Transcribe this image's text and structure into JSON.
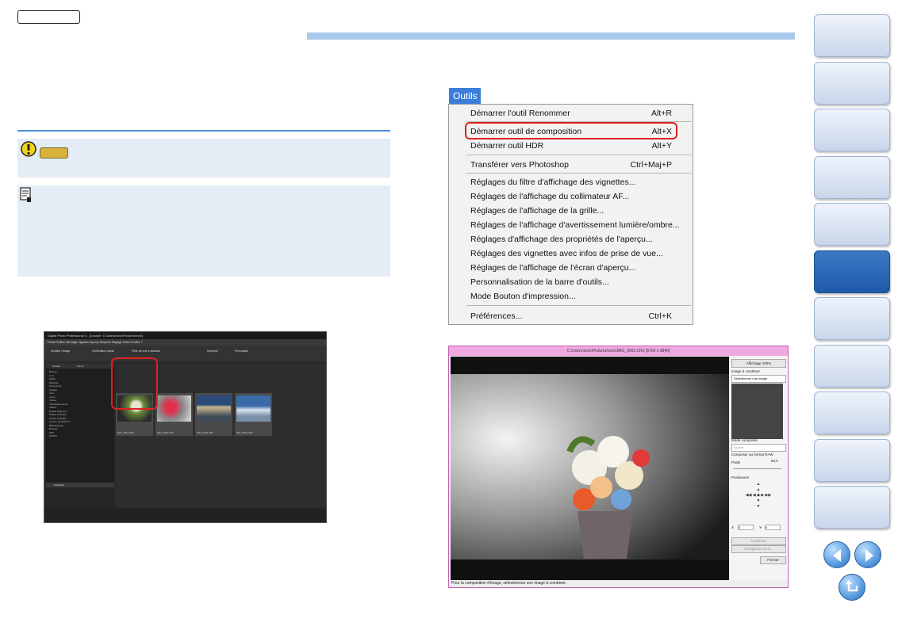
{
  "tools_menu": {
    "tab_label": "Outils",
    "items": [
      {
        "label": "Démarrer l'outil Renommer",
        "shortcut": "Alt+R"
      },
      {
        "label": "Démarrer outil de composition",
        "shortcut": "Alt+X"
      },
      {
        "label": "Démarrer outil HDR",
        "shortcut": "Alt+Y"
      },
      {
        "label": "Transférer vers Photoshop",
        "shortcut": "Ctrl+Maj+P"
      },
      {
        "label": "Réglages du filtre d'affichage des vignettes...",
        "shortcut": ""
      },
      {
        "label": "Réglages de l'affichage du collimateur AF...",
        "shortcut": ""
      },
      {
        "label": "Réglages de l'affichage de la grille...",
        "shortcut": ""
      },
      {
        "label": "Réglages de l'affichage d'avertissement lumière/ombre...",
        "shortcut": ""
      },
      {
        "label": "Réglages d'affichage des propriétés de l'aperçu...",
        "shortcut": ""
      },
      {
        "label": "Réglages des vignettes avec infos de prise de vue...",
        "shortcut": ""
      },
      {
        "label": "Réglages de l'affichage de l'écran d'aperçu...",
        "shortcut": ""
      },
      {
        "label": "Personnalisation de la barre d'outils...",
        "shortcut": ""
      },
      {
        "label": "Mode Bouton d'impression...",
        "shortcut": ""
      },
      {
        "label": "Préférences...",
        "shortcut": "Ctrl+K"
      }
    ]
  },
  "dpp_window": {
    "title": "Digital Photo Professional 4 - [Dossier: C:\\Users\\xxxx\\Pictures\\xxxx]",
    "menu": "Fichier  Edition  Affichage  Vignettes  Aperçu  Etiquette  Réglage  Outils  Fenêtre  ?",
    "toolbar": {
      "btn1": "Modifier l'image",
      "btn2": "Vérification rapide",
      "btn3": "Prise de vue à distance",
      "btn4": "Imprimer",
      "btn5": "Principales"
    },
    "tree_tabs": {
      "tab1": "Dossier",
      "tab2": "Favori"
    },
    "tree_items": [
      "Bureau",
      "xxxx",
      "Public",
      "Musique",
      "Documents",
      "Images",
      "xxxx",
      "xxxxx",
      "Vidéos",
      "Téléchargements",
      "Vidéos",
      "Disque local (C:)",
      "Disque local (D:)",
      "Disque local (E:)",
      "Lecteur de DVD (F:)",
      "Bibliothèques",
      "Réseau",
      "XXX",
      "XXXXX"
    ],
    "collection_label": "Collection",
    "thumbnails": [
      "IMG_0001.CR2",
      "IMG_0002.CR2",
      "IMG_0003.CR2",
      "IMG_0004.CR2"
    ]
  },
  "comp_window": {
    "title": "C:\\Users\\xxxx\\Pictures\\xxxx\\IMG_0001.CR2 [5760 x 3840]",
    "zoom_button": "Affichage 100%",
    "combine_label": "Image à combiner",
    "combine_select": "Sélectionner une image",
    "mode_label": "Mode composite",
    "mode_value": "Ajouter",
    "raw_checkbox": "Composer au format RAW",
    "weight_label": "Poids",
    "weight_value": "50,0",
    "position_label": "Positionner",
    "x_label": "X",
    "x_value": "0",
    "y_label": "Y",
    "y_value": "0",
    "continue_button": "Continuer",
    "save_button": "Enregistrer sous...",
    "close_button": "Fermer",
    "status": "Pour la composition d'image, sélectionnez une image à combiner."
  }
}
